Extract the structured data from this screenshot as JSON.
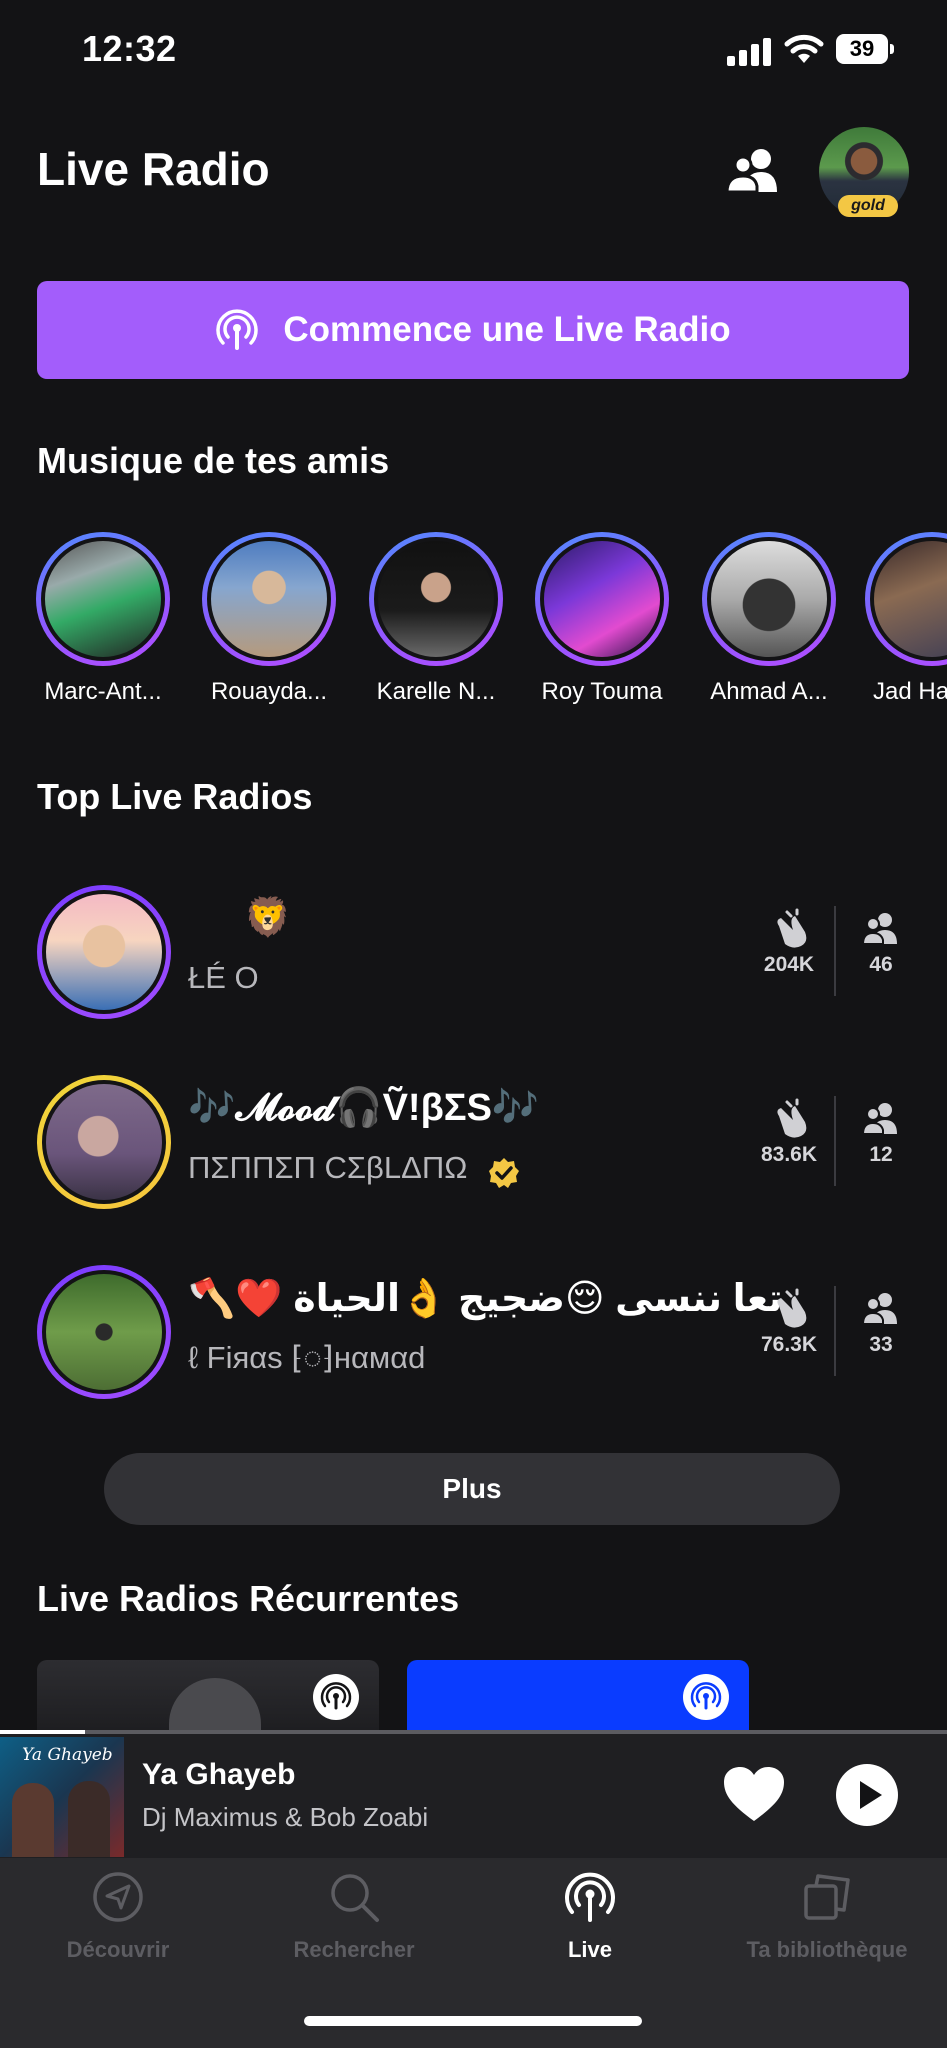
{
  "status_bar": {
    "time": "12:32",
    "battery": "39"
  },
  "header": {
    "title": "Live Radio",
    "badge": "gold"
  },
  "start_button": {
    "label": "Commence une Live Radio"
  },
  "friends_section": {
    "title": "Musique de tes amis",
    "friends": [
      {
        "name": "Marc-Ant..."
      },
      {
        "name": "Rouayda..."
      },
      {
        "name": "Karelle N..."
      },
      {
        "name": "Roy Touma"
      },
      {
        "name": "Ahmad A..."
      },
      {
        "name": "Jad Ha"
      }
    ]
  },
  "top_radios": {
    "title": "Top Live Radios",
    "items": [
      {
        "title": "🦁",
        "host": "ŁÉ O",
        "claps": "204K",
        "listeners": "46",
        "verified": false
      },
      {
        "title": "🎶𝓜𝓸𝓸𝓭🎧Ṽ!βΣS🎶",
        "host": "ΠΣΠΠΣΠ CΣβLΔΠΩ",
        "claps": "83.6K",
        "listeners": "12",
        "verified": true
      },
      {
        "title": "🪓❤️ تعا ننسى 😌ضجيج 👌الحياة",
        "host": "ℓ Fiяαs ⁅◌⁆нαмαd",
        "claps": "76.3K",
        "listeners": "33",
        "verified": false
      }
    ],
    "more_label": "Plus"
  },
  "recurring_section": {
    "title": "Live Radios Récurrentes"
  },
  "mini_player": {
    "title": "Ya Ghayeb",
    "artist": "Dj Maximus & Bob Zoabi",
    "art_text": "Ya Ghayeb",
    "progress": 0.09
  },
  "tabs": [
    {
      "label": "Découvrir",
      "icon": "compass-icon",
      "active": false
    },
    {
      "label": "Rechercher",
      "icon": "search-icon",
      "active": false
    },
    {
      "label": "Live",
      "icon": "live-radio-icon",
      "active": true
    },
    {
      "label": "Ta bibliothèque",
      "icon": "library-icon",
      "active": false
    }
  ],
  "colors": {
    "accent": "#a35dfb",
    "background": "#131315",
    "recurring_blue": "#0a3cff"
  }
}
